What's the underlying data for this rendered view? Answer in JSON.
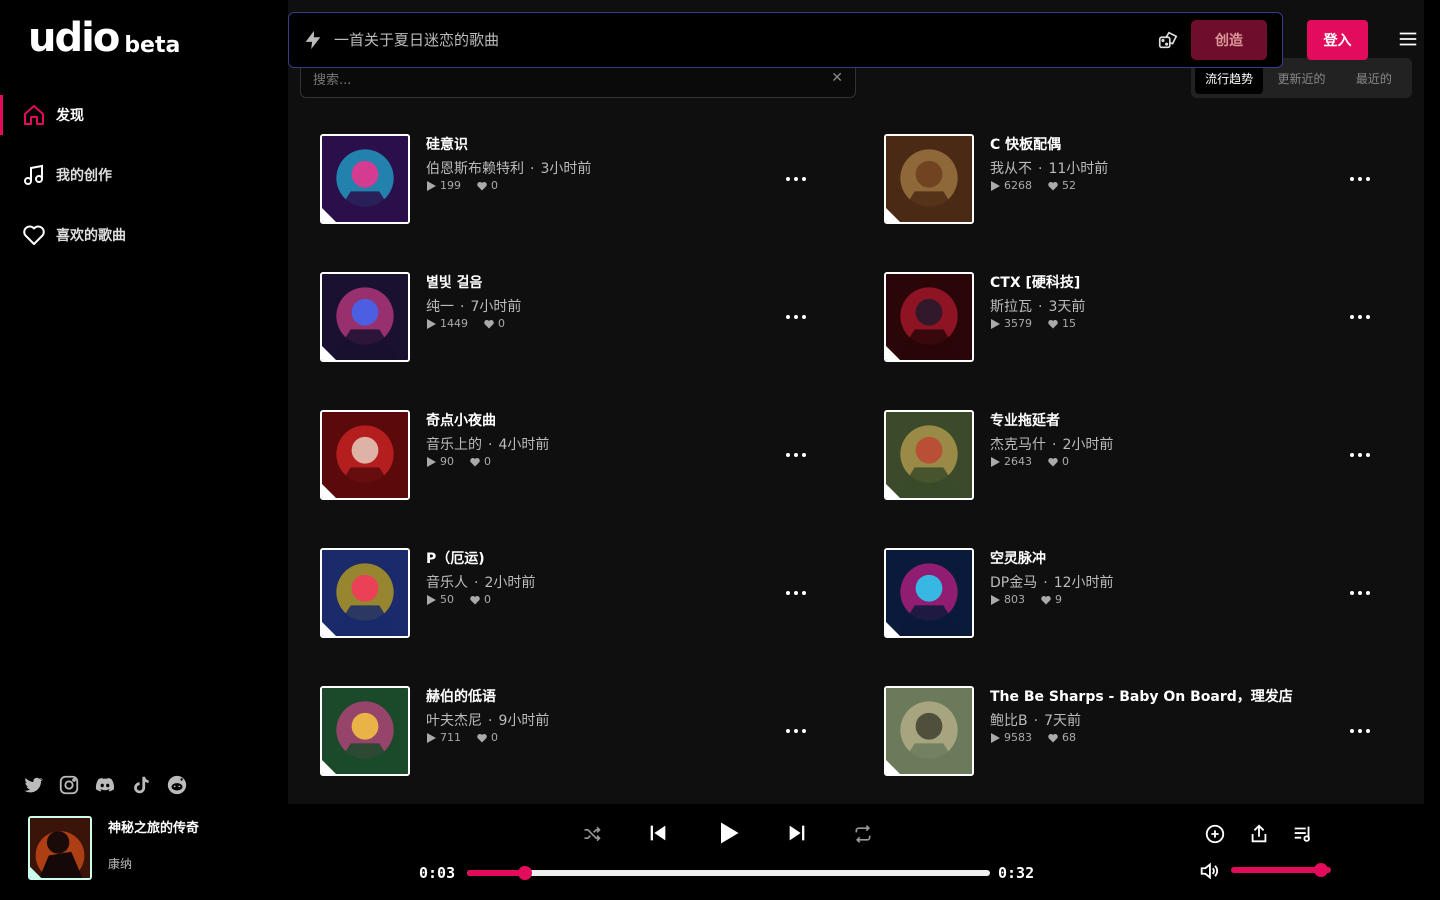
{
  "brand": {
    "name": "udio",
    "tag": "beta",
    "accent": "#e30b5c"
  },
  "nav": [
    {
      "label": "发现",
      "icon": "home-icon",
      "active": true
    },
    {
      "label": "我的创作",
      "icon": "music-note-icon",
      "active": false
    },
    {
      "label": "喜欢的歌曲",
      "icon": "heart-icon",
      "active": false
    }
  ],
  "prompt": {
    "placeholder": "一首关于夏日迷恋的歌曲",
    "create_label": "创造"
  },
  "login_label": "登入",
  "search": {
    "placeholder": "搜索..."
  },
  "sort_tabs": [
    {
      "label": "流行趋势",
      "active": true
    },
    {
      "label": "更新近的",
      "active": false
    },
    {
      "label": "最近的",
      "active": false
    }
  ],
  "songs": [
    {
      "title": "硅意识",
      "artist": "伯恩斯布赖特利",
      "time": "3小时前",
      "plays": "199",
      "likes": "0",
      "colors": [
        "#2a0f4a",
        "#1ee0ff",
        "#ff2a8a"
      ]
    },
    {
      "title": "C 快板配偶",
      "artist": "我从不",
      "time": "11小时前",
      "plays": "6268",
      "likes": "52",
      "colors": [
        "#4a2a14",
        "#c89a5a",
        "#6a3a1a"
      ]
    },
    {
      "title": "별빛 걸음",
      "artist": "纯一",
      "time": "7小时前",
      "plays": "1449",
      "likes": "0",
      "colors": [
        "#1a1030",
        "#ff4aa0",
        "#3a6aff"
      ]
    },
    {
      "title": "CTX [硬科技]",
      "artist": "斯拉瓦",
      "time": "3天前",
      "plays": "3579",
      "likes": "15",
      "colors": [
        "#2a0608",
        "#e0203a",
        "#1a1a2a"
      ]
    },
    {
      "title": "奇点小夜曲",
      "artist": "音乐上的",
      "time": "4小时前",
      "plays": "90",
      "likes": "0",
      "colors": [
        "#5a0a0a",
        "#ff3030",
        "#e8d8c8"
      ]
    },
    {
      "title": "专业拖延者",
      "artist": "杰克马什",
      "time": "2小时前",
      "plays": "2643",
      "likes": "0",
      "colors": [
        "#3a4a2a",
        "#e8c060",
        "#c04030"
      ]
    },
    {
      "title": "P（厄运)",
      "artist": "音乐人",
      "time": "2小时前",
      "plays": "50",
      "likes": "0",
      "colors": [
        "#1a2a6a",
        "#ffd000",
        "#ff3060"
      ]
    },
    {
      "title": "空灵脉冲",
      "artist": "DP金马",
      "time": "12小时前",
      "plays": "803",
      "likes": "9",
      "colors": [
        "#0a1a3a",
        "#ff20a0",
        "#20e0ff"
      ]
    },
    {
      "title": "赫伯的低语",
      "artist": "叶夫杰尼",
      "time": "9小时前",
      "plays": "711",
      "likes": "0",
      "colors": [
        "#1a4a2a",
        "#ff40a0",
        "#ffd040"
      ]
    },
    {
      "title": "The Be Sharps - Baby On Board，理发店",
      "artist": "鲍比B",
      "time": "7天前",
      "plays": "9583",
      "likes": "68",
      "colors": [
        "#6a7a5a",
        "#d8c8a0",
        "#3a3a2a"
      ]
    }
  ],
  "player": {
    "title": "神秘之旅的传奇",
    "artist": "康纳",
    "current_time": "0:03",
    "total_time": "0:32",
    "progress": 0.11,
    "volume": 0.9
  }
}
